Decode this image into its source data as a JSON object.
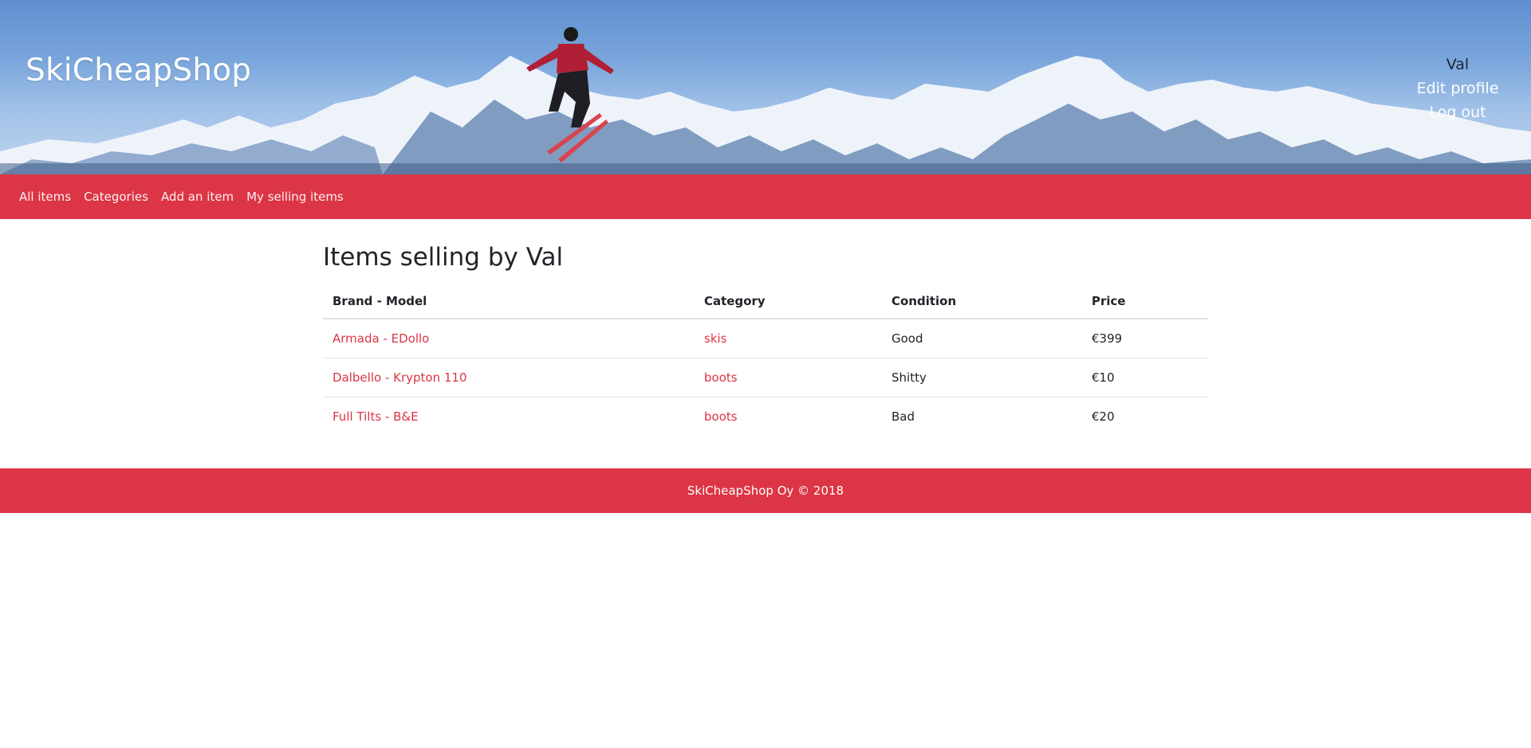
{
  "header": {
    "brand": "SkiCheapShop",
    "user_name": "Val",
    "edit_profile": "Edit profile",
    "log_out": "Log out"
  },
  "nav": {
    "items": [
      {
        "label": "All items"
      },
      {
        "label": "Categories"
      },
      {
        "label": "Add an item"
      },
      {
        "label": "My selling items"
      }
    ]
  },
  "main": {
    "title": "Items selling by Val",
    "table": {
      "headers": [
        "Brand - Model",
        "Category",
        "Condition",
        "Price"
      ],
      "rows": [
        {
          "model": "Armada - EDollo",
          "category": "skis",
          "condition": "Good",
          "price": "€399"
        },
        {
          "model": "Dalbello - Krypton 110",
          "category": "boots",
          "condition": "Shitty",
          "price": "€10"
        },
        {
          "model": "Full Tilts - B&E",
          "category": "boots",
          "condition": "Bad",
          "price": "€20"
        }
      ]
    }
  },
  "footer": {
    "text": "SkiCheapShop Oy © 2018"
  },
  "colors": {
    "accent": "#dc3545",
    "link": "#dc3545",
    "text": "#212529"
  }
}
